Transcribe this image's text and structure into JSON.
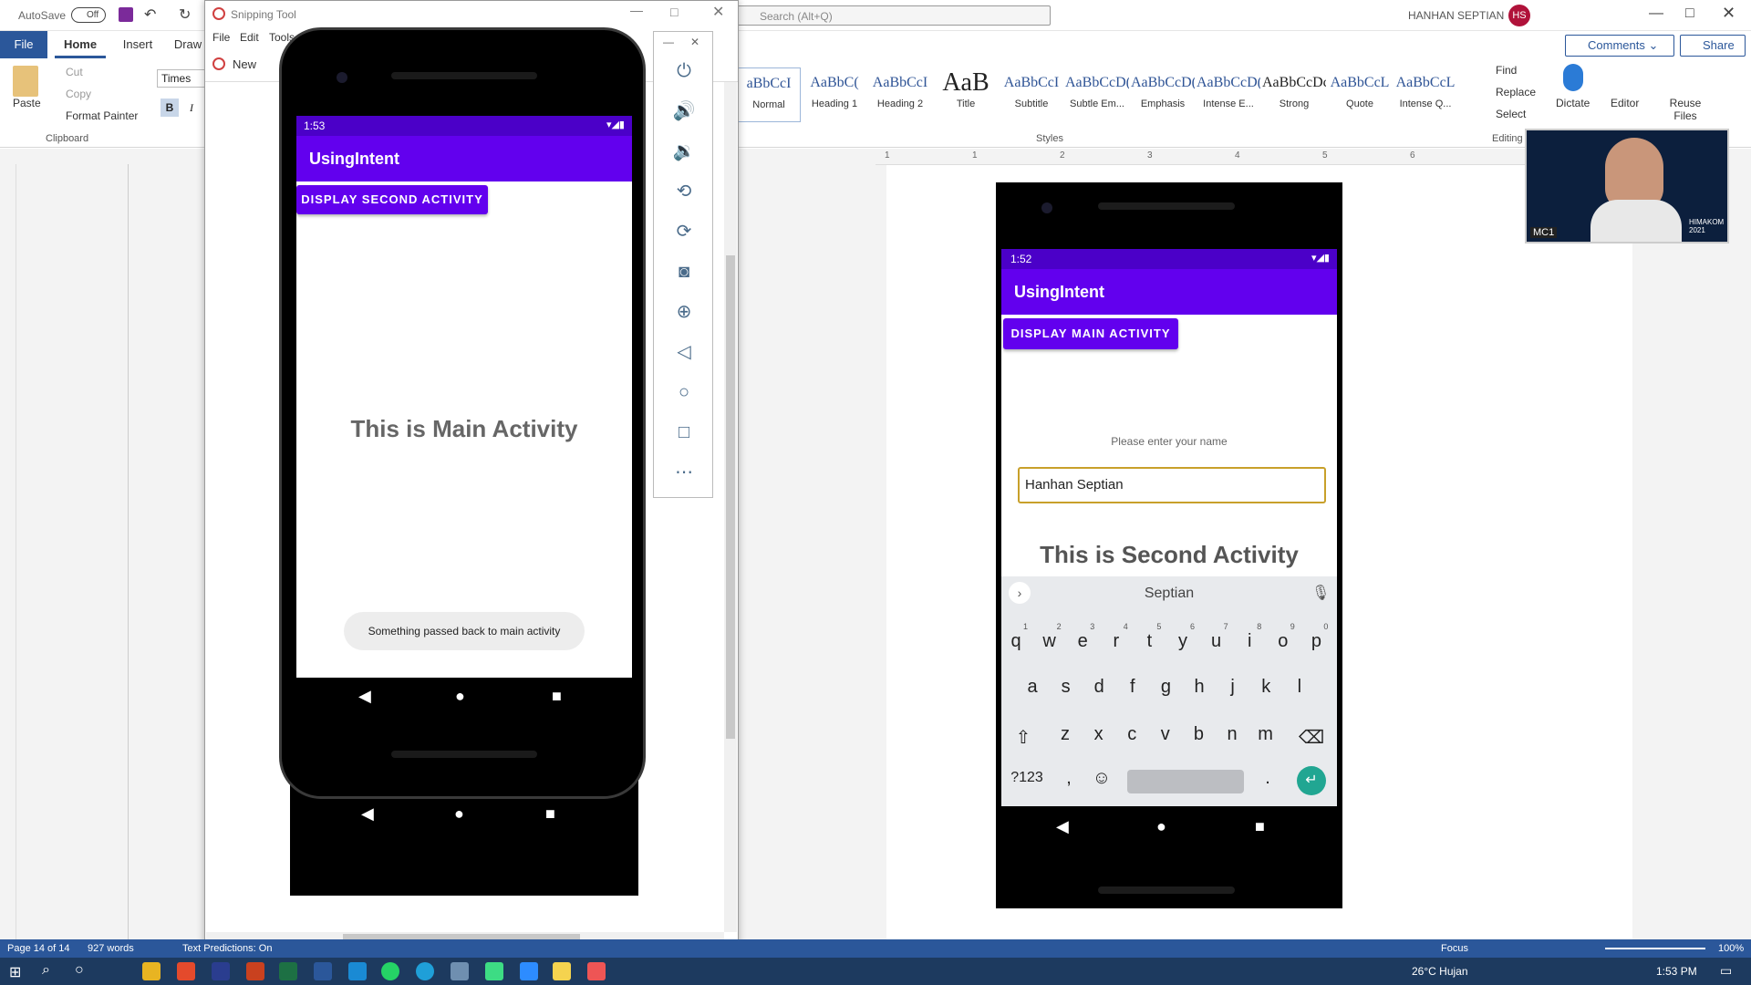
{
  "word": {
    "autosave": "AutoSave",
    "autosave_state": "Off",
    "search_placeholder": "Search (Alt+Q)",
    "user_name": "HANHAN SEPTIAN",
    "user_initials": "HS",
    "tabs": [
      "File",
      "Home",
      "Insert",
      "Draw"
    ],
    "clipboard": {
      "paste": "Paste",
      "cut": "Cut",
      "copy": "Copy",
      "format_painter": "Format Painter",
      "group": "Clipboard"
    },
    "font_name": "Times Ne",
    "styles": [
      {
        "sample": "aBbCcI",
        "name": "Normal"
      },
      {
        "sample": "AaBbC(",
        "name": "Heading 1"
      },
      {
        "sample": "AaBbCcI",
        "name": "Heading 2"
      },
      {
        "sample": "AaB",
        "name": "Title"
      },
      {
        "sample": "AaBbCcI",
        "name": "Subtitle"
      },
      {
        "sample": "AaBbCcD(",
        "name": "Subtle Em..."
      },
      {
        "sample": "AaBbCcD(",
        "name": "Emphasis"
      },
      {
        "sample": "AaBbCcD(",
        "name": "Intense E..."
      },
      {
        "sample": "AaBbCcDc",
        "name": "Strong"
      },
      {
        "sample": "AaBbCcL",
        "name": "Quote"
      },
      {
        "sample": "AaBbCcL",
        "name": "Intense Q..."
      }
    ],
    "styles_group": "Styles",
    "editing": {
      "find": "Find",
      "replace": "Replace",
      "select": "Select",
      "group": "Editing"
    },
    "dictate": "Dictate",
    "editor": "Editor",
    "reuse_files": "Reuse Files",
    "comments": "Comments",
    "share": "Share",
    "ruler_ticks": [
      "1",
      "1",
      "2",
      "3",
      "4",
      "5",
      "6"
    ],
    "status": {
      "page": "Page 14 of 14",
      "words": "927 words",
      "text_pred": "Text Predictions: On",
      "focus": "Focus",
      "zoom": "100%"
    }
  },
  "snipping": {
    "title": "Snipping Tool",
    "menu": [
      "File",
      "Edit",
      "Tools"
    ],
    "new_label": "New"
  },
  "phone_left": {
    "time": "1:53",
    "app_title": "UsingIntent",
    "button": "DISPLAY SECOND ACTIVITY",
    "heading": "This is Main Activity",
    "toast": "Something passed back to main activity"
  },
  "phone_right": {
    "time": "1:52",
    "app_title": "UsingIntent",
    "button": "DISPLAY MAIN ACTIVITY",
    "prompt": "Please enter your name",
    "input_value": "Hanhan Septian",
    "heading": "This is Second Activity",
    "suggestion": "Septian",
    "row1": [
      "q",
      "w",
      "e",
      "r",
      "t",
      "y",
      "u",
      "i",
      "o",
      "p"
    ],
    "row1_nums": [
      "1",
      "2",
      "3",
      "4",
      "5",
      "6",
      "7",
      "8",
      "9",
      "0"
    ],
    "row2": [
      "a",
      "s",
      "d",
      "f",
      "g",
      "h",
      "j",
      "k",
      "l"
    ],
    "row3": [
      "z",
      "x",
      "c",
      "v",
      "b",
      "n",
      "m"
    ],
    "sym_key": "?123",
    "comma": ",",
    "period": "."
  },
  "webcam": {
    "badge": "MC1",
    "brand": "HIMAKOM 2021"
  },
  "taskbar": {
    "weather": "26°C Hujan",
    "time": "1:53 PM"
  }
}
